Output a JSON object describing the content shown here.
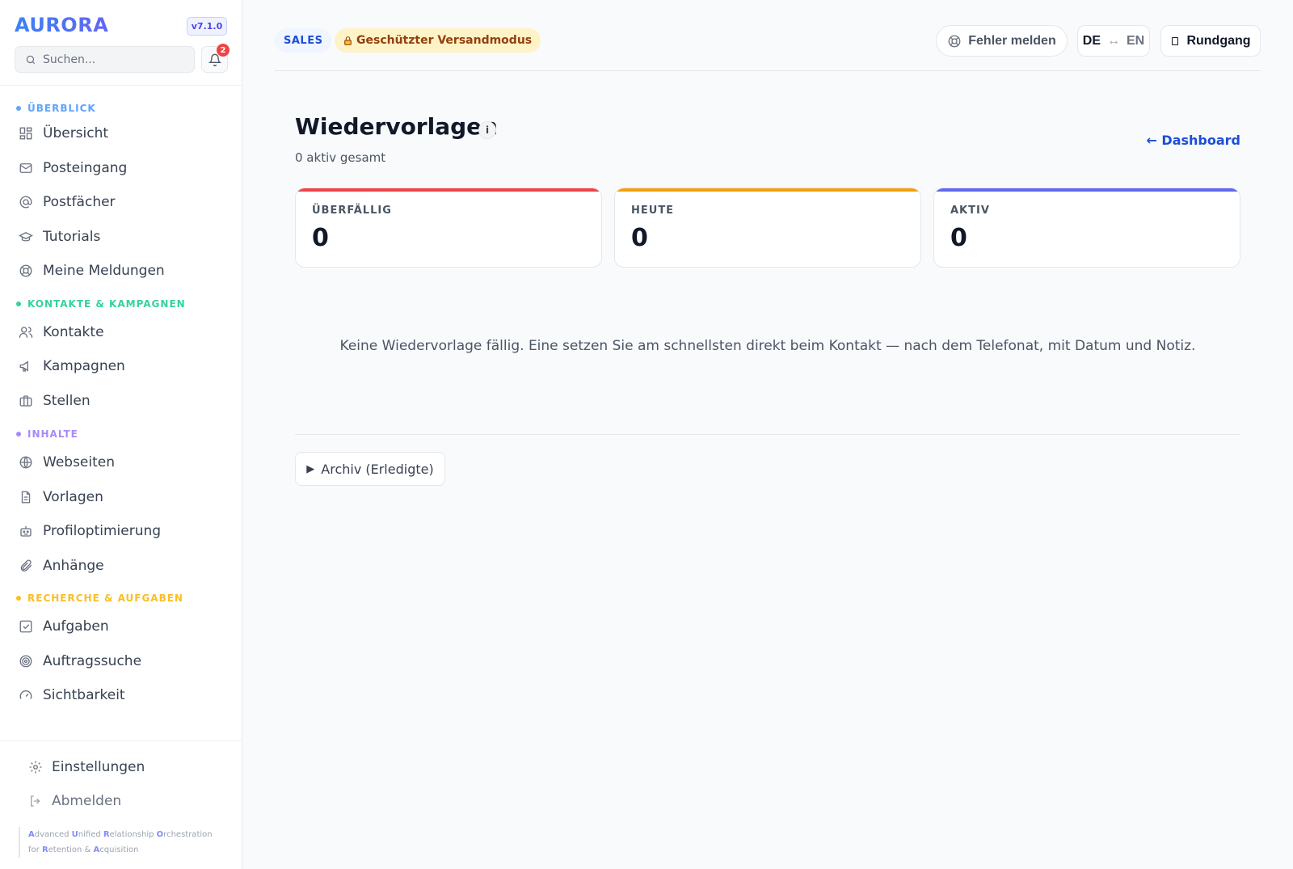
{
  "app": {
    "logo": "AURORA",
    "version": "v7.1.0"
  },
  "search": {
    "placeholder": "Suchen..."
  },
  "notifications": {
    "count": "2"
  },
  "sidebar": {
    "sections": [
      {
        "label": "ÜBERBLICK",
        "color": "#60a5fa"
      },
      {
        "label": "KONTAKTE & KAMPAGNEN",
        "color": "#34d399"
      },
      {
        "label": "INHALTE",
        "color": "#a78bfa"
      },
      {
        "label": "RECHERCHE & AUFGABEN",
        "color": "#fbbf24"
      }
    ],
    "items": [
      {
        "label": "Übersicht",
        "icon": "grid-icon"
      },
      {
        "label": "Posteingang",
        "icon": "mail-icon"
      },
      {
        "label": "Postfächer",
        "icon": "at-icon"
      },
      {
        "label": "Tutorials",
        "icon": "graduation-cap-icon"
      },
      {
        "label": "Meine Meldungen",
        "icon": "lifebuoy-icon"
      },
      {
        "label": "Kontakte",
        "icon": "users-icon"
      },
      {
        "label": "Kampagnen",
        "icon": "megaphone-icon"
      },
      {
        "label": "Stellen",
        "icon": "briefcase-icon"
      },
      {
        "label": "Webseiten",
        "icon": "globe-icon"
      },
      {
        "label": "Vorlagen",
        "icon": "file-text-icon"
      },
      {
        "label": "Profiloptimierung",
        "icon": "robot-icon"
      },
      {
        "label": "Anhänge",
        "icon": "paperclip-icon"
      },
      {
        "label": "Aufgaben",
        "icon": "check-square-icon"
      },
      {
        "label": "Auftragssuche",
        "icon": "target-icon"
      },
      {
        "label": "Sichtbarkeit",
        "icon": "gauge-icon"
      }
    ],
    "bottom": [
      {
        "label": "Einstellungen",
        "icon": "gear-icon"
      },
      {
        "label": "Abmelden",
        "icon": "logout-icon"
      }
    ],
    "acronym": {
      "w1": "A",
      "r1": "dvanced ",
      "w2": "U",
      "r2": "nified ",
      "w3": "R",
      "r3": "elationship ",
      "w4": "O",
      "r4": "rchestration for ",
      "w5": "R",
      "r5": "etention & ",
      "w6": "A",
      "r6": "cquisition"
    }
  },
  "topbar": {
    "mode_pill": "SALES",
    "safe_mode": "Geschützter Versandmodus",
    "report_error": "Fehler melden",
    "lang_active": "DE",
    "lang_arrow": "↔",
    "lang_other": "EN",
    "tour": "Rundgang"
  },
  "page": {
    "title": "Wiedervorlagen",
    "info": "i",
    "subtitle": "0 aktiv gesamt",
    "back_link": "← Dashboard",
    "stats": [
      {
        "label": "ÜBERFÄLLIG",
        "value": "0",
        "color": "#ef4444"
      },
      {
        "label": "HEUTE",
        "value": "0",
        "color": "#f59e0b"
      },
      {
        "label": "AKTIV",
        "value": "0",
        "color": "#6366f1"
      }
    ],
    "empty_message": "Keine Wiedervorlage fällig. Eine setzen Sie am schnellsten direkt beim Kontakt — nach dem Telefonat, mit Datum und Notiz.",
    "archive_button": "Archiv (Erledigte)",
    "archive_icon": "▶"
  }
}
